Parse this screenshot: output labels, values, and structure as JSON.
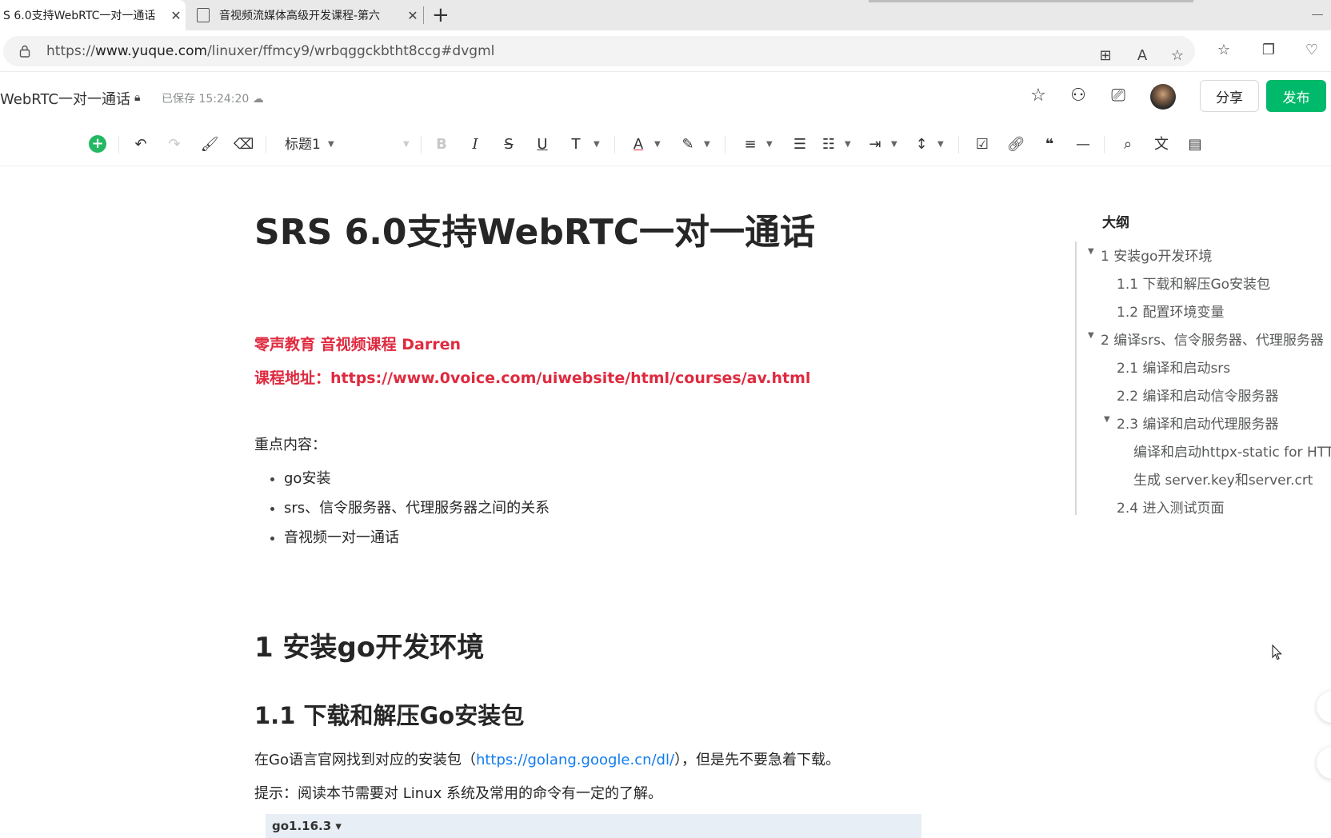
{
  "browser": {
    "tabs": [
      {
        "title": "S 6.0支持WebRTC一对一通话",
        "close": "✕"
      },
      {
        "title": "音视频流媒体高级开发课程-第六",
        "close": "✕"
      }
    ],
    "new_tab": "+",
    "url_prefix": "https://",
    "url_domain": "www.yuque.com",
    "url_path": "/linuxer/ffmcy9/wrbqggckbtht8ccg#dvgml"
  },
  "app": {
    "doc_name": "WebRTC一对一通话",
    "saved_status": "已保存 15:24:20",
    "share_label": "分享",
    "publish_label": "发布"
  },
  "toolbar": {
    "heading_style": "标题1"
  },
  "document": {
    "title": "SRS 6.0支持WebRTC一对一通话",
    "red_line1": "零声教育 音视频课程 Darren",
    "red_line2": "课程地址：https://www.0voice.com/uiwebsite/html/courses/av.html",
    "key_points_label": "重点内容：",
    "bullets": [
      "go安装",
      "srs、信令服务器、代理服务器之间的关系",
      "音视频一对一通话"
    ],
    "h1": "1 安装go开发环境",
    "h2": "1.1 下载和解压Go安装包",
    "para1_before": "在Go语言官网找到对应的安装包（",
    "para1_link": "https://golang.google.cn/dl/",
    "para1_after": "），但是先不要急着下载。",
    "para2": "提示：阅读本节需要对 Linux 系统及常用的命令有一定的了解。",
    "code_version": "go1.16.3 ▾"
  },
  "outline": {
    "title": "大纲",
    "items": [
      {
        "label": "1 安装go开发环境",
        "level": 1,
        "expanded": true
      },
      {
        "label": "1.1 下载和解压Go安装包",
        "level": 2
      },
      {
        "label": "1.2 配置环境变量",
        "level": 2
      },
      {
        "label": "2 编译srs、信令服务器、代理服务器",
        "level": 1,
        "expanded": true
      },
      {
        "label": "2.1 编译和启动srs",
        "level": 2
      },
      {
        "label": "2.2 编译和启动信令服务器",
        "level": 2
      },
      {
        "label": "2.3 编译和启动代理服务器",
        "level": 2,
        "expanded": true
      },
      {
        "label": "编译和启动httpx-static for HTTP",
        "level": 3
      },
      {
        "label": "生成 server.key和server.crt",
        "level": 3
      },
      {
        "label": "2.4 进入测试页面",
        "level": 2
      }
    ]
  },
  "colors": {
    "accent_green": "#00b96b",
    "red_text": "#df2a3f",
    "link_blue": "#117cee"
  }
}
